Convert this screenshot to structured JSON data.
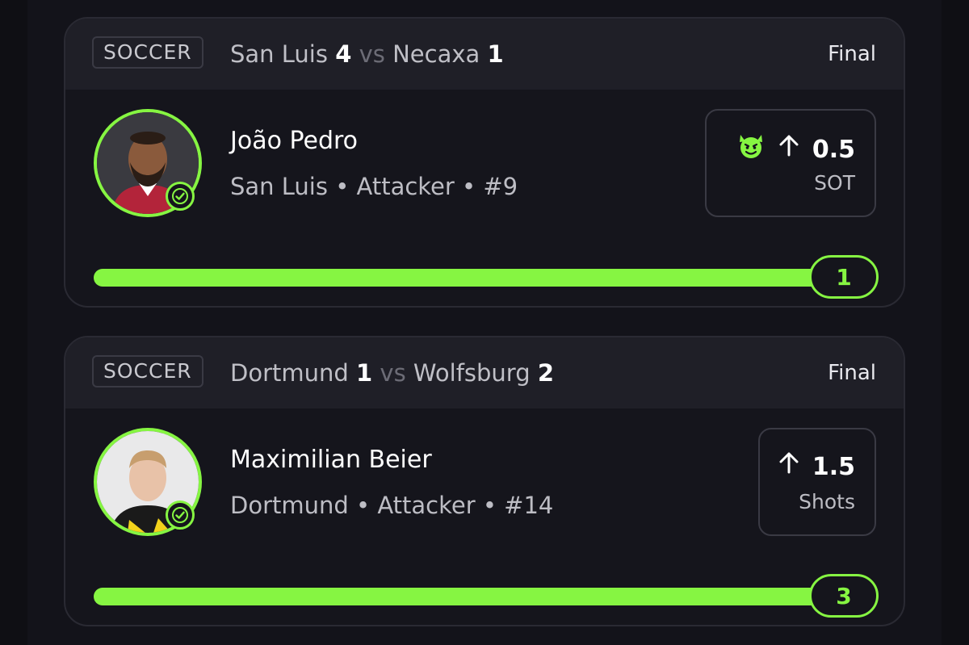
{
  "cards": [
    {
      "sport": "SOCCER",
      "team_a": "San Luis",
      "score_a": "4",
      "vs": "vs",
      "team_b": "Necaxa",
      "score_b": "1",
      "status": "Final",
      "player": {
        "name": "João Pedro",
        "meta": "San Luis • Attacker • #9",
        "avatar_icon": "player-headshot",
        "verified_icon": "check-circle-icon"
      },
      "pick": {
        "badge_icon": "devil-emoji-icon",
        "direction_icon": "arrow-up-icon",
        "line": "0.5",
        "stat": "SOT"
      },
      "result": "1",
      "progress_fraction": 1.0
    },
    {
      "sport": "SOCCER",
      "team_a": "Dortmund",
      "score_a": "1",
      "vs": "vs",
      "team_b": "Wolfsburg",
      "score_b": "2",
      "status": "Final",
      "player": {
        "name": "Maximilian Beier",
        "meta": "Dortmund • Attacker • #14",
        "avatar_icon": "player-headshot",
        "verified_icon": "check-circle-icon"
      },
      "pick": {
        "direction_icon": "arrow-up-icon",
        "line": "1.5",
        "stat": "Shots"
      },
      "result": "3",
      "progress_fraction": 1.0
    }
  ],
  "colors": {
    "accent": "#86f542",
    "background": "#0f0f14",
    "card": "#15151c",
    "header": "#1f1f27"
  }
}
